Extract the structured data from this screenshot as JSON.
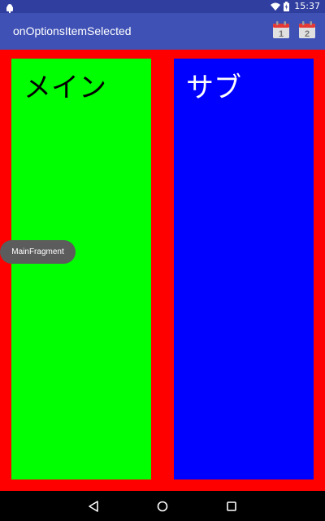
{
  "status_bar": {
    "time": "15:37",
    "left_icon": "android-notification-icon",
    "icons": [
      "wifi-icon",
      "battery-icon"
    ]
  },
  "app_bar": {
    "title": "onOptionsItemSelected",
    "actions": [
      {
        "icon": "calendar-1-icon",
        "label": "1"
      },
      {
        "icon": "calendar-2-icon",
        "label": "2"
      }
    ]
  },
  "panes": {
    "main": {
      "label": "メイン",
      "color": "#00ff00"
    },
    "sub": {
      "label": "サブ",
      "color": "#0000ff"
    }
  },
  "toast": {
    "text": "MainFragment"
  },
  "nav_bar": {
    "buttons": [
      "back-icon",
      "home-icon",
      "recents-icon"
    ]
  },
  "colors": {
    "status_bar": "#303f9f",
    "app_bar": "#3f51b5",
    "background": "#ff0000",
    "main_pane": "#00ff00",
    "sub_pane": "#0000ff"
  }
}
